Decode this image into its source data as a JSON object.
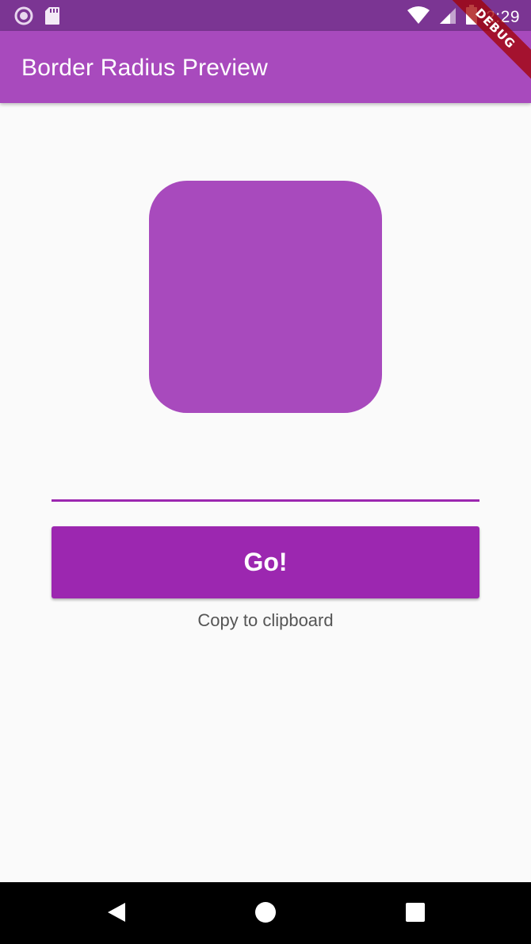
{
  "status_bar": {
    "time": "2:29",
    "icons_left": [
      "record-icon",
      "sd-card-icon"
    ],
    "icons_right": [
      "wifi-icon",
      "signal-icon",
      "battery-icon"
    ],
    "background": "#7b3593"
  },
  "debug_banner": {
    "label": "DEBUG"
  },
  "app_bar": {
    "title": "Border Radius Preview",
    "background": "#a84abd"
  },
  "preview": {
    "color": "#a84abd"
  },
  "input": {
    "value": "",
    "underline_color": "#9c27b0"
  },
  "go_button": {
    "label": "Go!",
    "background": "#9c27b0"
  },
  "copy_link": {
    "label": "Copy to clipboard"
  },
  "nav_bar": {
    "buttons": [
      "back-icon",
      "home-icon",
      "recents-icon"
    ]
  }
}
